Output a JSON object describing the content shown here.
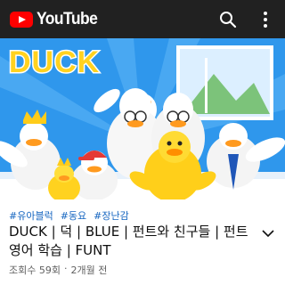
{
  "app": {
    "logo_text": "YouTube",
    "logo_icon": "youtube-play-icon",
    "brand_color": "#ff0000",
    "topbar_color": "#212121"
  },
  "header": {
    "search_icon": "search-icon",
    "menu_icon": "more-vert-icon"
  },
  "video": {
    "thumbnail_title": "DUCK",
    "tags": [
      "#유아블럭",
      "#동요",
      "#장난감"
    ],
    "title": "DUCK | 덕 | BLUE | 펀트와 친구들 | 펀트 영어 학습 | FUNT",
    "views": "조회수 59회",
    "separator": "·",
    "uploaded": "2개월 전",
    "tag_color": "#1565c0"
  }
}
